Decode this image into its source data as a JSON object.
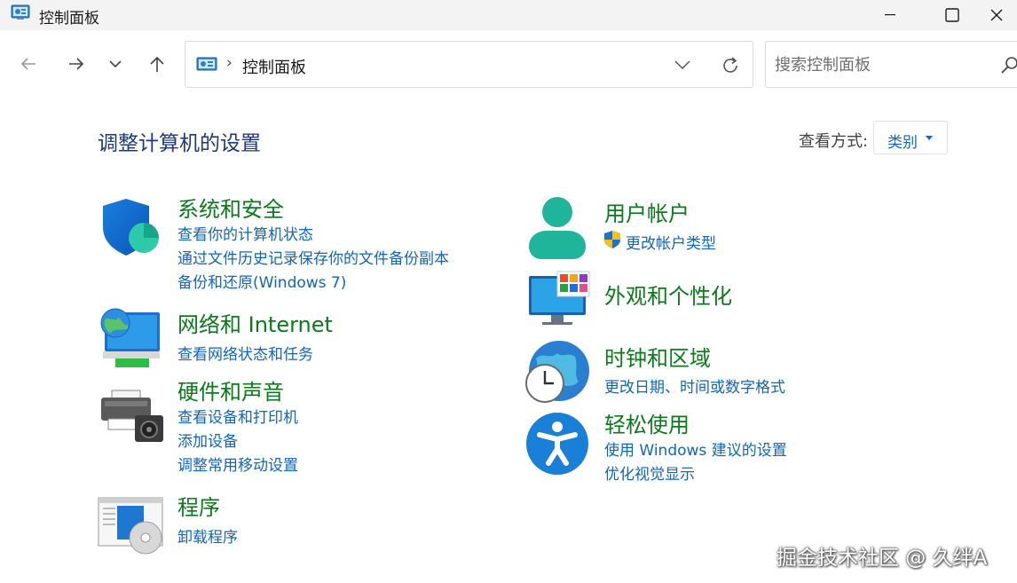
{
  "window": {
    "title": "控制面板"
  },
  "nav": {
    "breadcrumb_sep": "›",
    "address_text": "控制面板",
    "search_placeholder": "搜索控制面板"
  },
  "header": {
    "title": "调整计算机的设置",
    "view_label": "查看方式:",
    "view_value": "类别"
  },
  "categories": {
    "security": {
      "title": "系统和安全",
      "links": [
        "查看你的计算机状态",
        "通过文件历史记录保存你的文件备份副本",
        "备份和还原(Windows 7)"
      ]
    },
    "network": {
      "title": "网络和 Internet",
      "links": [
        "查看网络状态和任务"
      ]
    },
    "hardware": {
      "title": "硬件和声音",
      "links": [
        "查看设备和打印机",
        "添加设备",
        "调整常用移动设置"
      ]
    },
    "programs": {
      "title": "程序",
      "links": [
        "卸载程序"
      ]
    },
    "accounts": {
      "title": "用户帐户",
      "links": [
        "更改帐户类型"
      ]
    },
    "appearance": {
      "title": "外观和个性化",
      "links": []
    },
    "clock": {
      "title": "时钟和区域",
      "links": [
        "更改日期、时间或数字格式"
      ]
    },
    "ease": {
      "title": "轻松使用",
      "links": [
        "使用 Windows 建议的设置",
        "优化视觉显示"
      ]
    }
  },
  "watermark": "掘金技术社区 @ 久绊A",
  "colors": {
    "title_green": "#0a7a1a",
    "link_blue": "#1066b8",
    "heading_blue": "#1e3a78"
  }
}
